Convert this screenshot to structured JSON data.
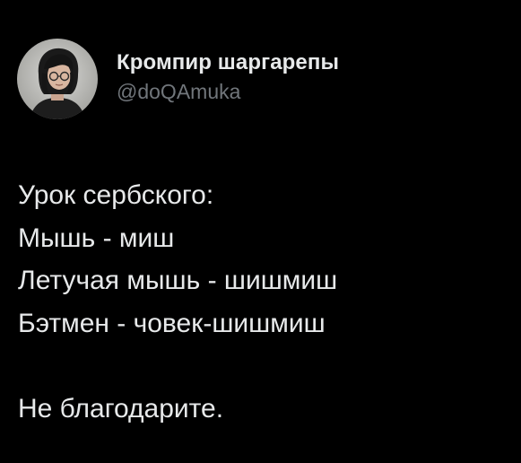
{
  "author": {
    "display_name": "Кромпир шаргарепы",
    "handle": "@doQAmuka"
  },
  "tweet": {
    "lines": [
      "Урок сербского:",
      "Мышь - миш",
      "Летучая мышь - шишмиш",
      "Бэтмен - човек-шишмиш",
      "",
      "Не благодарите."
    ]
  },
  "colors": {
    "background": "#000000",
    "text_primary": "#e7e9ea",
    "text_secondary": "#71767b"
  }
}
